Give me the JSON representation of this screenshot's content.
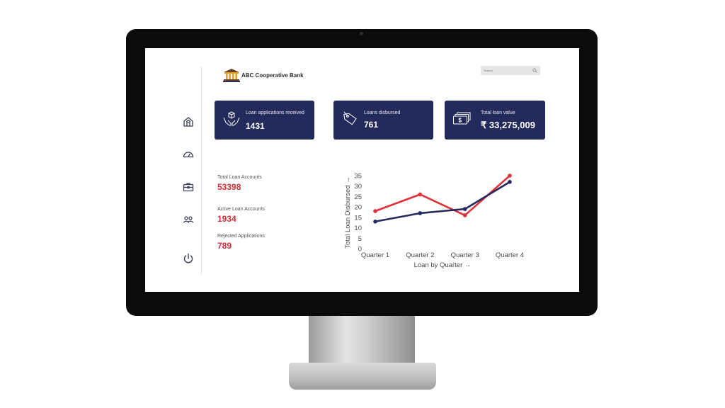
{
  "app": {
    "brand_name": "ABC Cooperative Bank",
    "search_placeholder": "Search"
  },
  "sidebar": {
    "items": [
      {
        "name": "home",
        "icon": "home-icon"
      },
      {
        "name": "dashboard",
        "icon": "speedometer-icon"
      },
      {
        "name": "portfolio",
        "icon": "briefcase-icon"
      },
      {
        "name": "customers",
        "icon": "users-icon"
      },
      {
        "name": "logout",
        "icon": "power-icon"
      }
    ]
  },
  "cards": [
    {
      "label": "Loan applications received",
      "value": "1431",
      "icon": "hands-box-icon"
    },
    {
      "label": "Loans disbursed",
      "value": "761",
      "icon": "tag-icon"
    },
    {
      "label": "Total loan value",
      "value": "₹ 33,275,009",
      "icon": "cash-icon"
    }
  ],
  "stats": [
    {
      "label": "Total Loan Accounts",
      "value": "53398"
    },
    {
      "label": "Active Loan Accounts",
      "value": "1934"
    },
    {
      "label": "Rejected Applications",
      "value": "789"
    }
  ],
  "colors": {
    "card_bg": "#232a5c",
    "accent_red": "#d32f35",
    "navy": "#232a5c"
  },
  "chart_data": {
    "type": "line",
    "categories": [
      "Quarter 1",
      "Quarter 2",
      "Quarter 3",
      "Quarter 4"
    ],
    "series": [
      {
        "color": "#e03038",
        "values": [
          18,
          26,
          16,
          35
        ]
      },
      {
        "color": "#252a5e",
        "values": [
          13,
          17,
          19,
          32
        ]
      }
    ],
    "y_ticks": [
      "0",
      "5",
      "10",
      "15",
      "20",
      "25",
      "30",
      "35"
    ],
    "xlabel": "Loan by Quarter →",
    "ylabel": "Total Loan Disbursed →",
    "ylim": [
      0,
      35
    ],
    "grid": false
  }
}
